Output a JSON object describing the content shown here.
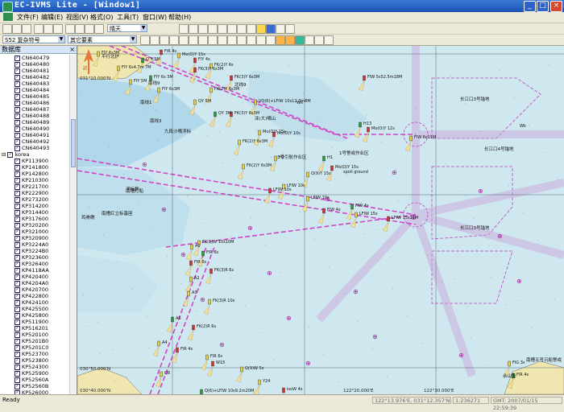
{
  "window": {
    "title": "EC-IVMS Lite - [Window1]"
  },
  "menu": [
    "文件(F)",
    "编辑(E)",
    "视图(V)",
    "格式(O)",
    "工具(T)",
    "窗口(W)",
    "帮助(H)"
  ],
  "toolbar": {
    "weather": "晴天",
    "symbol_set": "S52 复杂符号",
    "display_category": "其它要素"
  },
  "panel": {
    "title": "数据库",
    "cn_items": [
      "CN640479",
      "CN640480",
      "CN640481",
      "CN640482",
      "CN640483",
      "CN640484",
      "CN640485",
      "CN640486",
      "CN640487",
      "CN640488",
      "CN640489",
      "CN640490",
      "CN640491",
      "CN640492",
      "CN640493"
    ],
    "group": "korea",
    "kr_items": [
      "KP113900",
      "KP141800",
      "KP142800",
      "KP210300",
      "KP221700",
      "KP222900",
      "KP273200",
      "KP314200",
      "KP314400",
      "KP317600",
      "KP320200",
      "KP321000",
      "KP320900",
      "KP3224A0",
      "KP3224B0",
      "KP323600",
      "KP326400",
      "KP4118AA",
      "KP420400",
      "KP4204A0",
      "KP420700",
      "KP422800",
      "KP424100",
      "KP425500",
      "KP425800",
      "KP511900",
      "KP516201",
      "KP520100",
      "KP5201B0",
      "KP5201C0",
      "KP523700",
      "KP523800",
      "KP524300",
      "KP525900",
      "KP52560A",
      "KP52560B",
      "KP526000"
    ]
  },
  "map": {
    "labels": [
      {
        "t": "FlY 6s3M"
      },
      {
        "t": "FlY 6s4.7m 7M"
      },
      {
        "t": "Q Y 5M"
      },
      {
        "t": "FlR 4s"
      },
      {
        "t": "Mo(O)Y 15s"
      },
      {
        "t": "FlY 4s"
      },
      {
        "t": "FlY 5M"
      },
      {
        "t": "FlY 6s3M"
      },
      {
        "t": "FlY 6s 3M"
      },
      {
        "t": "FK(3)Y 6s3M"
      },
      {
        "t": "FK(2)Y 6s"
      },
      {
        "t": "FK(3)Y 6s3M"
      },
      {
        "t": "QY 5M"
      },
      {
        "t": "FK(2)Y 6s3M"
      },
      {
        "t": "QY 3M"
      },
      {
        "t": "FK(3)Y 6s3M"
      },
      {
        "t": "VQ(6)+LFlW 10s12.7m8M"
      },
      {
        "t": "FlW 5s52.5m18M"
      },
      {
        "t": "Mo(O)Y 15s"
      },
      {
        "t": "FK(2)Y 6s3M"
      },
      {
        "t": "H13"
      },
      {
        "t": "Mo(O)Y 12s"
      },
      {
        "t": "FlW 6s11M"
      },
      {
        "t": "Mo(O)Y 10s"
      },
      {
        "t": "Q(9)Y 15s"
      },
      {
        "t": "H2"
      },
      {
        "t": "H1"
      },
      {
        "t": "Mo(O)Y 15s"
      },
      {
        "t": "FK(2)Y 6s3M"
      },
      {
        "t": "LFlW 10s"
      },
      {
        "t": "LFlW 10s"
      },
      {
        "t": "LFlW 10s"
      },
      {
        "t": "FlW 4s"
      },
      {
        "t": "FlW 4s"
      },
      {
        "t": "LFlW 15s"
      },
      {
        "t": "LFlW 15s11M"
      },
      {
        "t": "A1"
      },
      {
        "t": "FK(1)W 10s10M"
      },
      {
        "t": "FlR 6s"
      },
      {
        "t": "FlR 6s"
      },
      {
        "t": "A2"
      },
      {
        "t": "FK(3)R 6s"
      },
      {
        "t": "A3"
      },
      {
        "t": "FK(3)R 10s"
      },
      {
        "t": "A6"
      },
      {
        "t": "FK(2)R 6s"
      },
      {
        "t": "A4"
      },
      {
        "t": "FlR 4s"
      },
      {
        "t": "QR"
      },
      {
        "t": "FlR 6s"
      },
      {
        "t": "Q(6)+LFlW 10s9.2m20M"
      },
      {
        "t": "W15"
      },
      {
        "t": "Y24"
      },
      {
        "t": "IsoW 4s"
      },
      {
        "t": "Q(9)W 5s"
      },
      {
        "t": "FlG 3s"
      },
      {
        "t": "FlR 4s"
      },
      {
        "t": "平行北护"
      },
      {
        "t": "北线9"
      },
      {
        "t": "南线9"
      },
      {
        "t": "南线1"
      },
      {
        "t": "九段沙嘴浮标"
      },
      {
        "t": "南线3"
      },
      {
        "t": "南槽灯船"
      },
      {
        "t": "1号警戒作业区"
      },
      {
        "t": "长江口3号锚地"
      },
      {
        "t": "长江口3号锚地"
      },
      {
        "t": "长江口4号锚地"
      },
      {
        "t": "3号引航作业区"
      },
      {
        "t": "浮标群"
      },
      {
        "t": "南槽红立标基座"
      },
      {
        "t": "鸡骨礁"
      },
      {
        "t": "南槽五号沉船警戒"
      },
      {
        "t": "佘山岛"
      },
      {
        "t": "泽(大)嘴山"
      },
      {
        "t": "Wk"
      },
      {
        "t": "spoil ground"
      },
      {
        "t": "Wk"
      }
    ],
    "lat_labels": [
      "031°10.000'N",
      "030°50.000'N",
      "030°40.000'N"
    ],
    "lon_label": "122°20.000'E",
    "lon_label2": "122°30.000'E",
    "compass": "N"
  },
  "status": {
    "ready": "Ready",
    "coord": "122°13.976'E, 031°12.357'N",
    "scale": "1:236271",
    "time": "GMT: 2007/01/15 22:59:39"
  },
  "colors": {
    "water": "#cfe8ef",
    "land": "#f0e6b0",
    "route": "#d044c8",
    "grid": "#556677"
  }
}
